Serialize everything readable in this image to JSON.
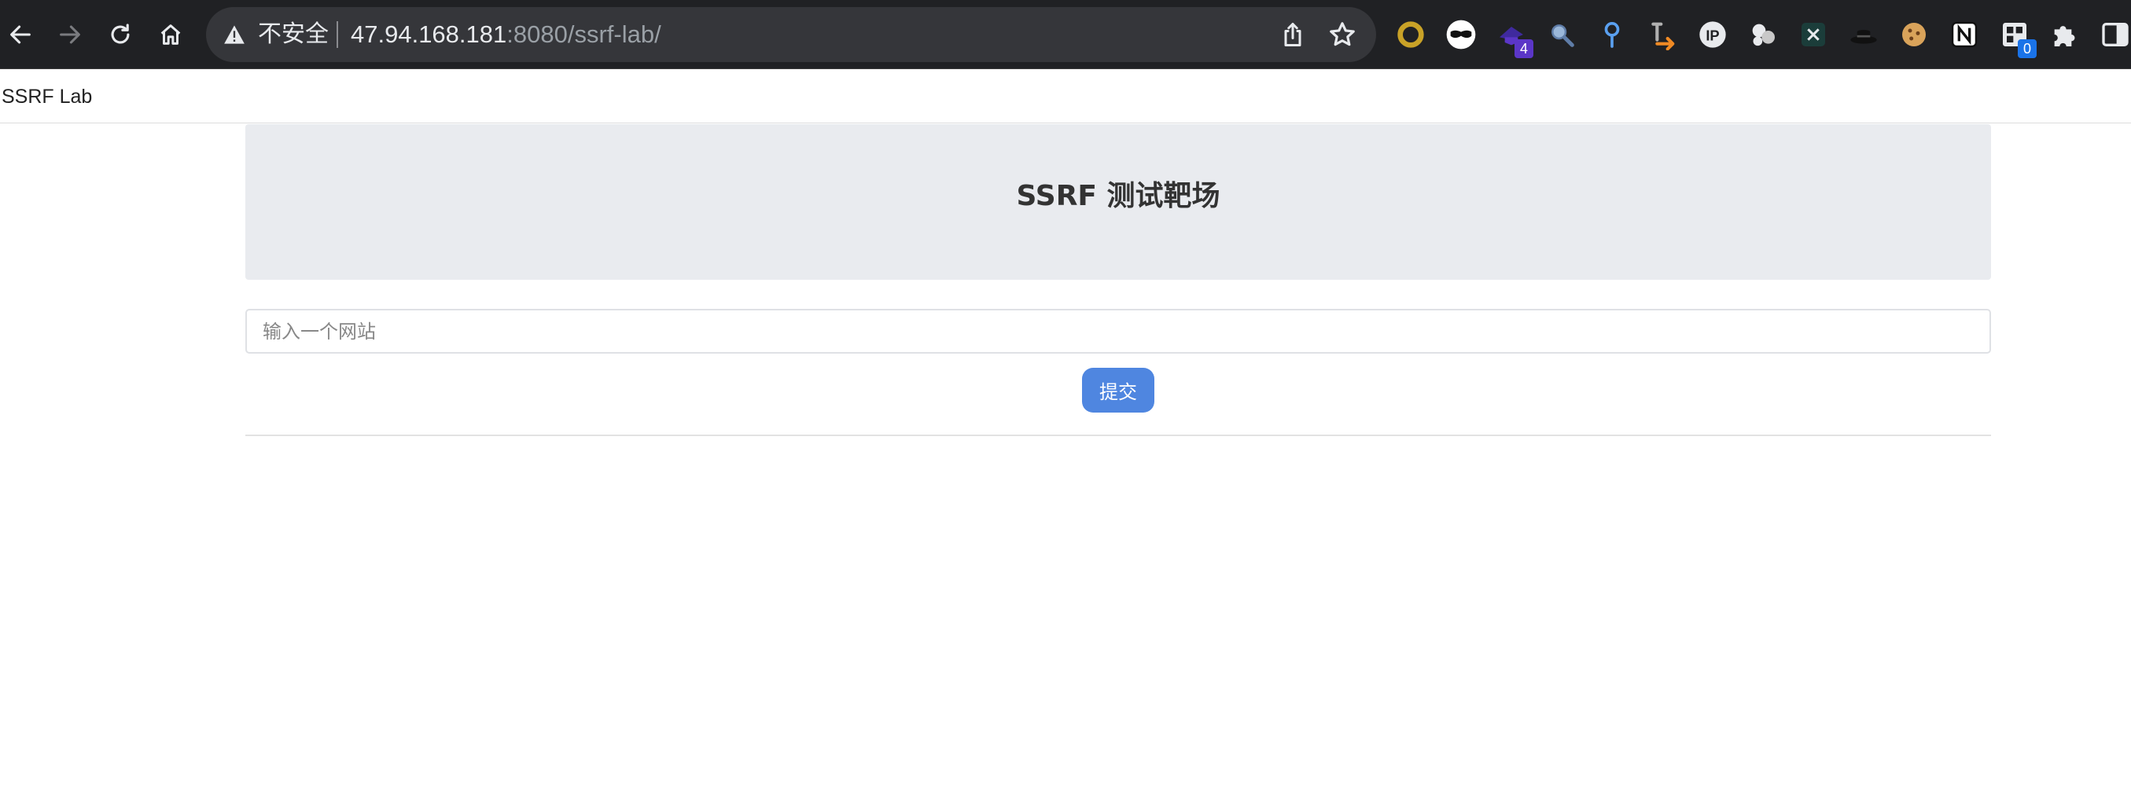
{
  "browser": {
    "security_label": "不安全",
    "url_host": "47.94.168.181",
    "url_path": ":8080/ssrf-lab/",
    "icons": [
      "back-icon",
      "forward-icon",
      "reload-icon",
      "home-icon",
      "warning-icon",
      "share-icon",
      "star-icon"
    ],
    "extensions": [
      {
        "name": "ring-extension-icon",
        "badge": ""
      },
      {
        "name": "mask-extension-icon",
        "badge": ""
      },
      {
        "name": "wizard-hat-extension-icon",
        "badge": "4",
        "badge_color": "#5b36c7"
      },
      {
        "name": "magnifier-extension-icon",
        "badge": ""
      },
      {
        "name": "pin-extension-icon",
        "badge": ""
      },
      {
        "name": "arrow-extension-icon",
        "badge": ""
      },
      {
        "name": "ip-extension-icon",
        "badge": ""
      },
      {
        "name": "cookie-cluster-extension-icon",
        "badge": ""
      },
      {
        "name": "x-extension-icon",
        "badge": ""
      },
      {
        "name": "hat-extension-icon",
        "badge": ""
      },
      {
        "name": "cookie-extension-icon",
        "badge": ""
      },
      {
        "name": "notion-extension-icon",
        "badge": ""
      },
      {
        "name": "qr-extension-icon",
        "badge": "0",
        "badge_color": "#1a73e8"
      },
      {
        "name": "puzzle-icon",
        "badge": ""
      },
      {
        "name": "side-panel-icon",
        "badge": ""
      }
    ]
  },
  "page": {
    "brand": "SSRF Lab",
    "title": "SSRF 测试靶场",
    "input_placeholder": "输入一个网站",
    "submit_label": "提交"
  },
  "colors": {
    "chrome_bg": "#202124",
    "omnibox_bg": "#35363a",
    "hero_bg": "#e9ebef",
    "button_bg": "#4f86e0"
  }
}
